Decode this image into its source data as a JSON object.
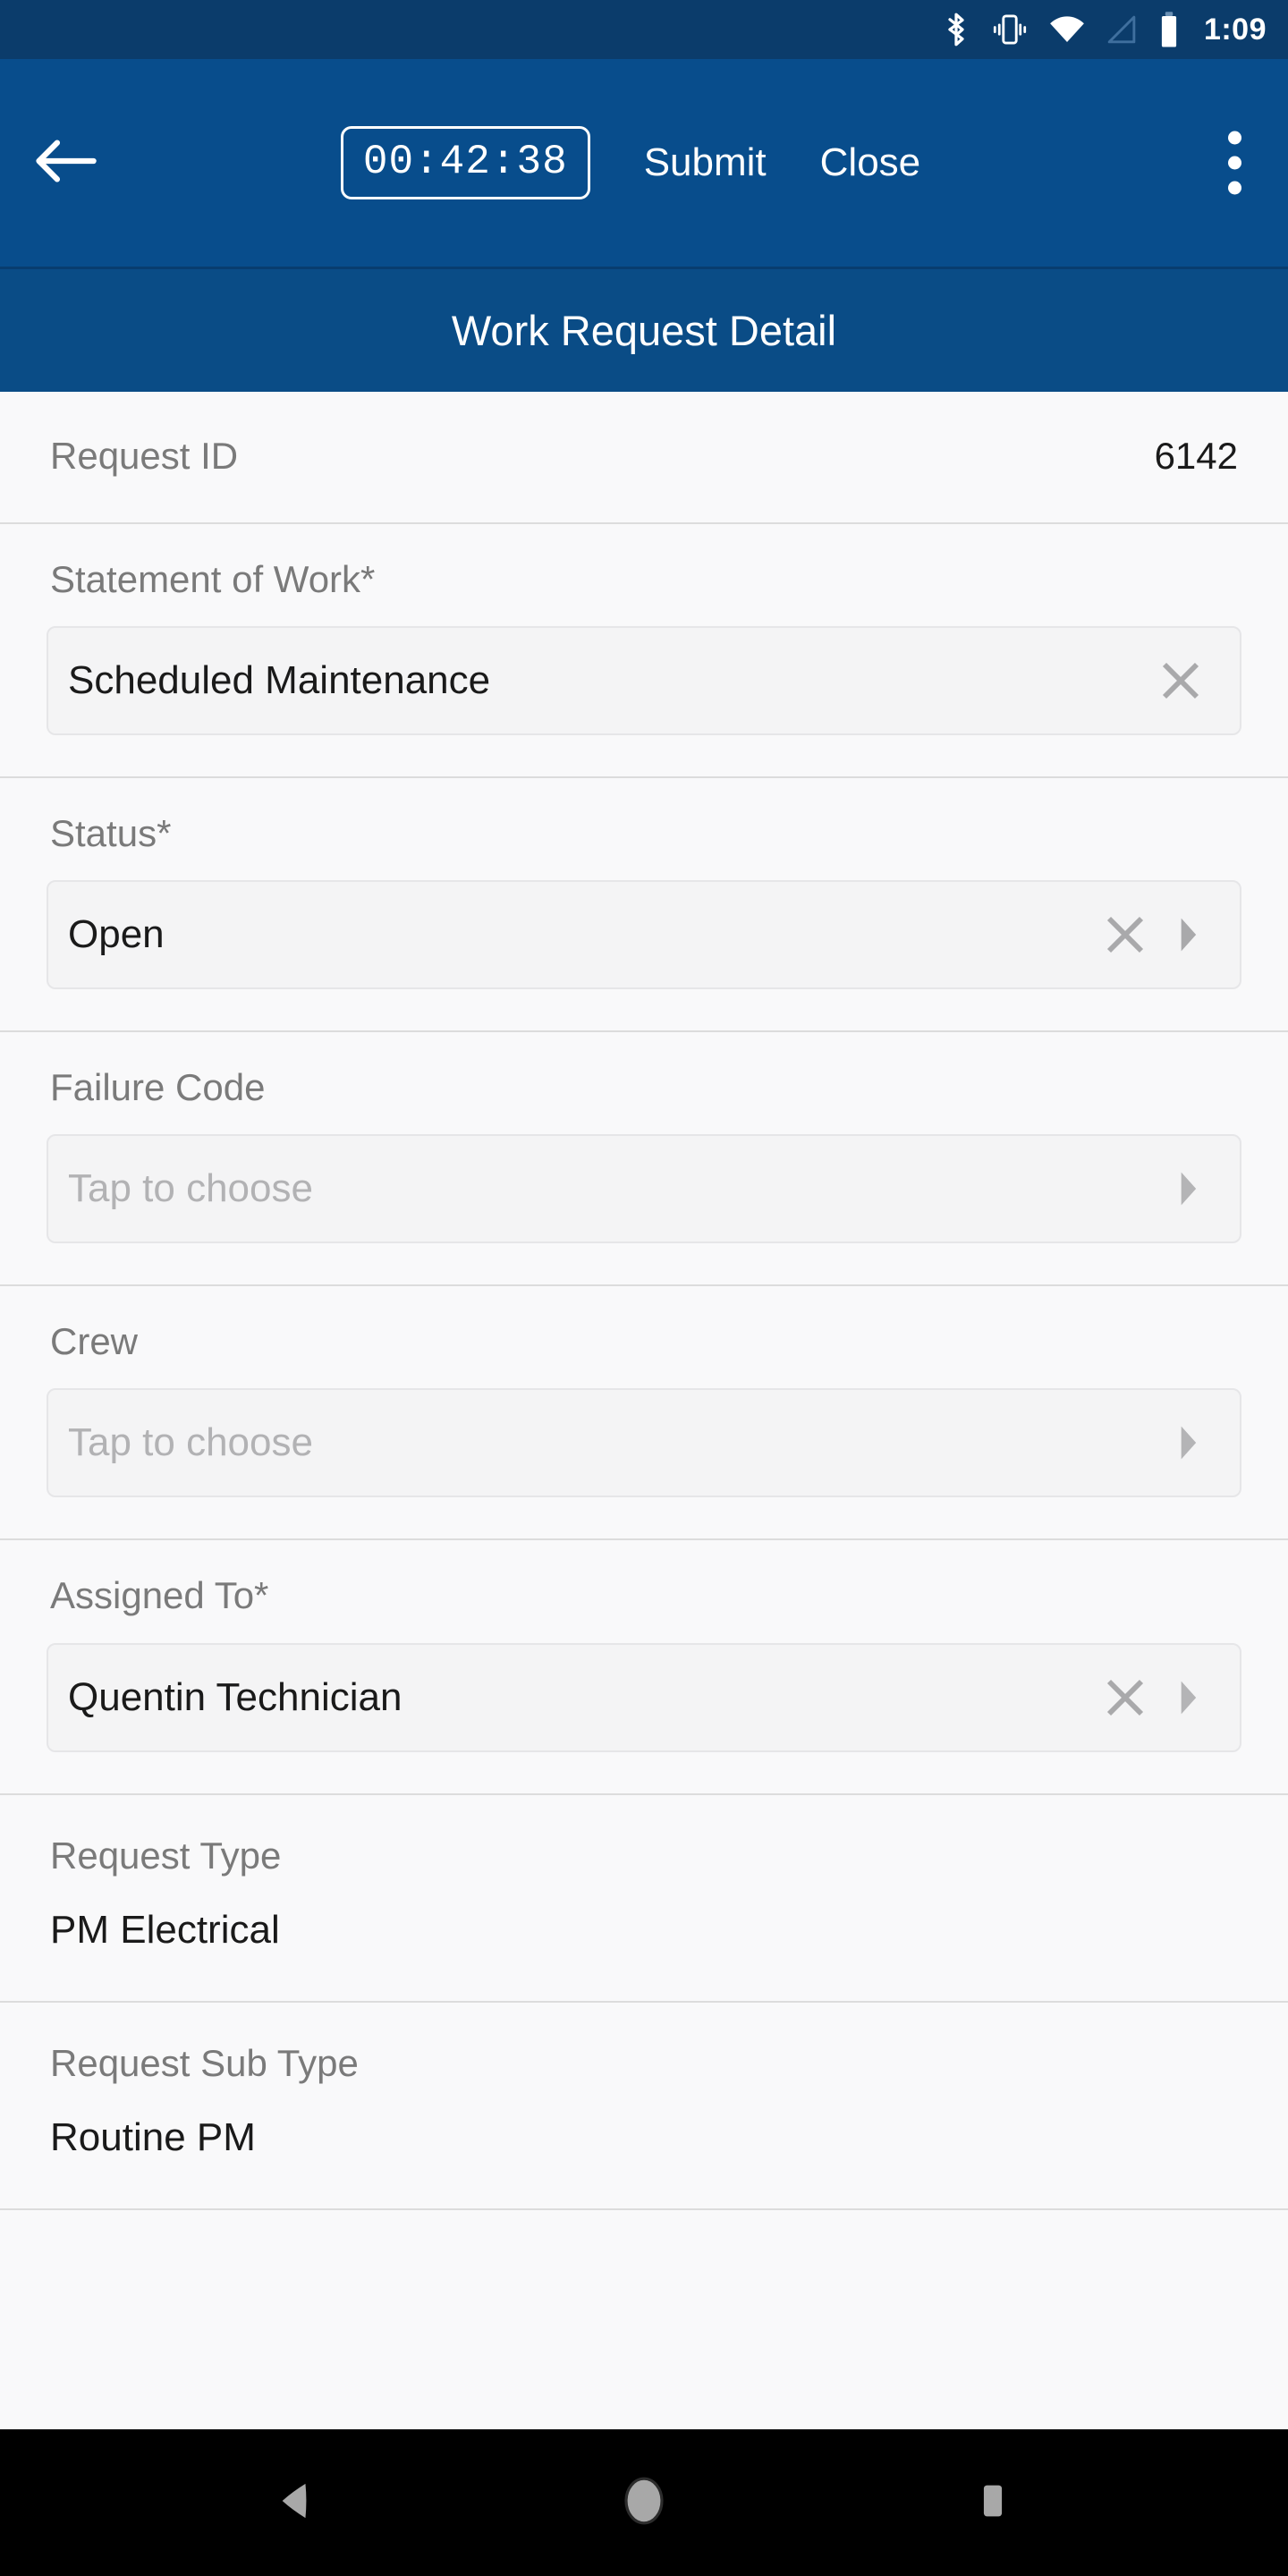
{
  "status_bar": {
    "icons": [
      "bluetooth-icon",
      "vibrate-icon",
      "wifi-icon",
      "cellular-signal-icon",
      "battery-icon"
    ],
    "time": "1:09"
  },
  "app_bar": {
    "back_icon": "back-arrow-icon",
    "timer": "00:42:38",
    "submit_label": "Submit",
    "close_label": "Close",
    "overflow_icon": "more-vertical-icon"
  },
  "subtitle": {
    "title": "Work Request Detail"
  },
  "form": {
    "request_id": {
      "label": "Request ID",
      "value": "6142"
    },
    "statement_of_work": {
      "label": "Statement of Work*",
      "value": "Scheduled Maintenance",
      "clear_icon": "clear-x-icon"
    },
    "status": {
      "label": "Status*",
      "value": "Open",
      "clear_icon": "clear-x-icon",
      "caret_icon": "caret-right-icon"
    },
    "failure_code": {
      "label": "Failure Code",
      "placeholder": "Tap to choose",
      "caret_icon": "caret-right-icon"
    },
    "crew": {
      "label": "Crew",
      "placeholder": "Tap to choose",
      "caret_icon": "caret-right-icon"
    },
    "assigned_to": {
      "label": "Assigned To*",
      "value": "Quentin Technician",
      "clear_icon": "clear-x-icon",
      "caret_icon": "caret-right-icon"
    },
    "request_type": {
      "label": "Request Type",
      "value": "PM Electrical"
    },
    "request_sub_type": {
      "label": "Request Sub Type",
      "value": "Routine PM"
    }
  },
  "nav_bar": {
    "back_icon": "nav-back-triangle-icon",
    "home_icon": "nav-home-circle-icon",
    "recents_icon": "nav-recents-square-icon"
  },
  "colors": {
    "status_bar_bg": "#0b3c6b",
    "app_bar_bg": "#084d8c",
    "subtitle_bg": "#0a4c86",
    "content_bg": "#f9f9fa",
    "field_bg": "#f4f4f5",
    "divider": "#dcdcdc",
    "label_text": "#7a7a7a",
    "value_text": "#1a1a1a",
    "placeholder_text": "#b2b2b4",
    "nav_bar_bg": "#000000"
  }
}
